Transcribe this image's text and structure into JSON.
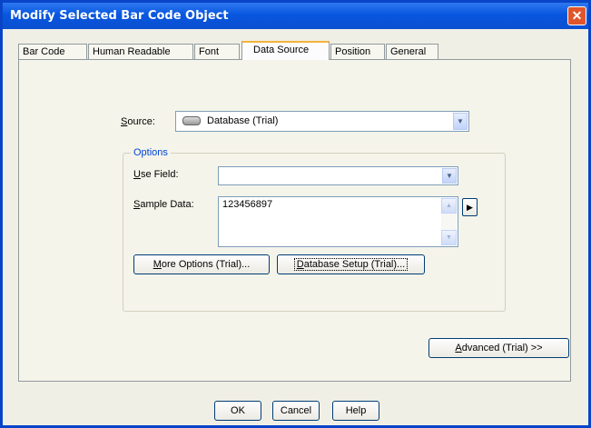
{
  "window": {
    "title": "Modify Selected Bar Code Object",
    "close_symbol": "✕"
  },
  "tabs": [
    {
      "label": "Bar Code"
    },
    {
      "label": "Human Readable"
    },
    {
      "label": "Font"
    },
    {
      "label": "Data Source",
      "active": true
    },
    {
      "label": "Position"
    },
    {
      "label": "General"
    }
  ],
  "source": {
    "label_letter": "S",
    "label_rest": "ource:",
    "value": "Database (Trial)",
    "icon": "database-icon"
  },
  "options": {
    "group_title": "Options",
    "use_field": {
      "label_letter": "U",
      "label_rest": "se Field:",
      "value": ""
    },
    "sample_data": {
      "label_letter": "S",
      "label_rest": "ample Data:",
      "value": "123456897"
    },
    "more_options": {
      "letter": "M",
      "rest": "ore Options (Trial)..."
    },
    "database_setup": {
      "letter": "D",
      "rest": "atabase Setup (Trial)..."
    }
  },
  "advanced": {
    "letter": "A",
    "rest": "dvanced (Trial) >>"
  },
  "footer": {
    "ok": "OK",
    "cancel": "Cancel",
    "help": "Help"
  },
  "colors": {
    "titlebar": "#0857df",
    "dialog_bg": "#f0efe6",
    "active_tab_accent": "#f2b33d",
    "group_title": "#0046d5"
  }
}
